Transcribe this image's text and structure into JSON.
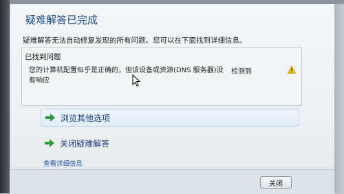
{
  "window": {
    "title": "疑难解答已完成",
    "description": "疑难解答无法自动修复发现的所有问题。您可以在下面找到详细信息。"
  },
  "problems": {
    "header": "已找到问题",
    "items": [
      {
        "text": "您的计算机配置似乎是正确的，但该设备或资源(DNS 服务器)没有响应",
        "status": "检测到",
        "icon": "warning-icon"
      }
    ]
  },
  "options": {
    "browse_label": "浏览其他选项",
    "close_label": "关闭疑难解答",
    "icon": "green-arrow-icon"
  },
  "details_link": "查看详细信息",
  "footer": {
    "close_button": "关闭"
  },
  "colors": {
    "title": "#1d4a8c",
    "link": "#2156a5",
    "arrow": "#2f9a3a",
    "warning": "#f2c300"
  }
}
